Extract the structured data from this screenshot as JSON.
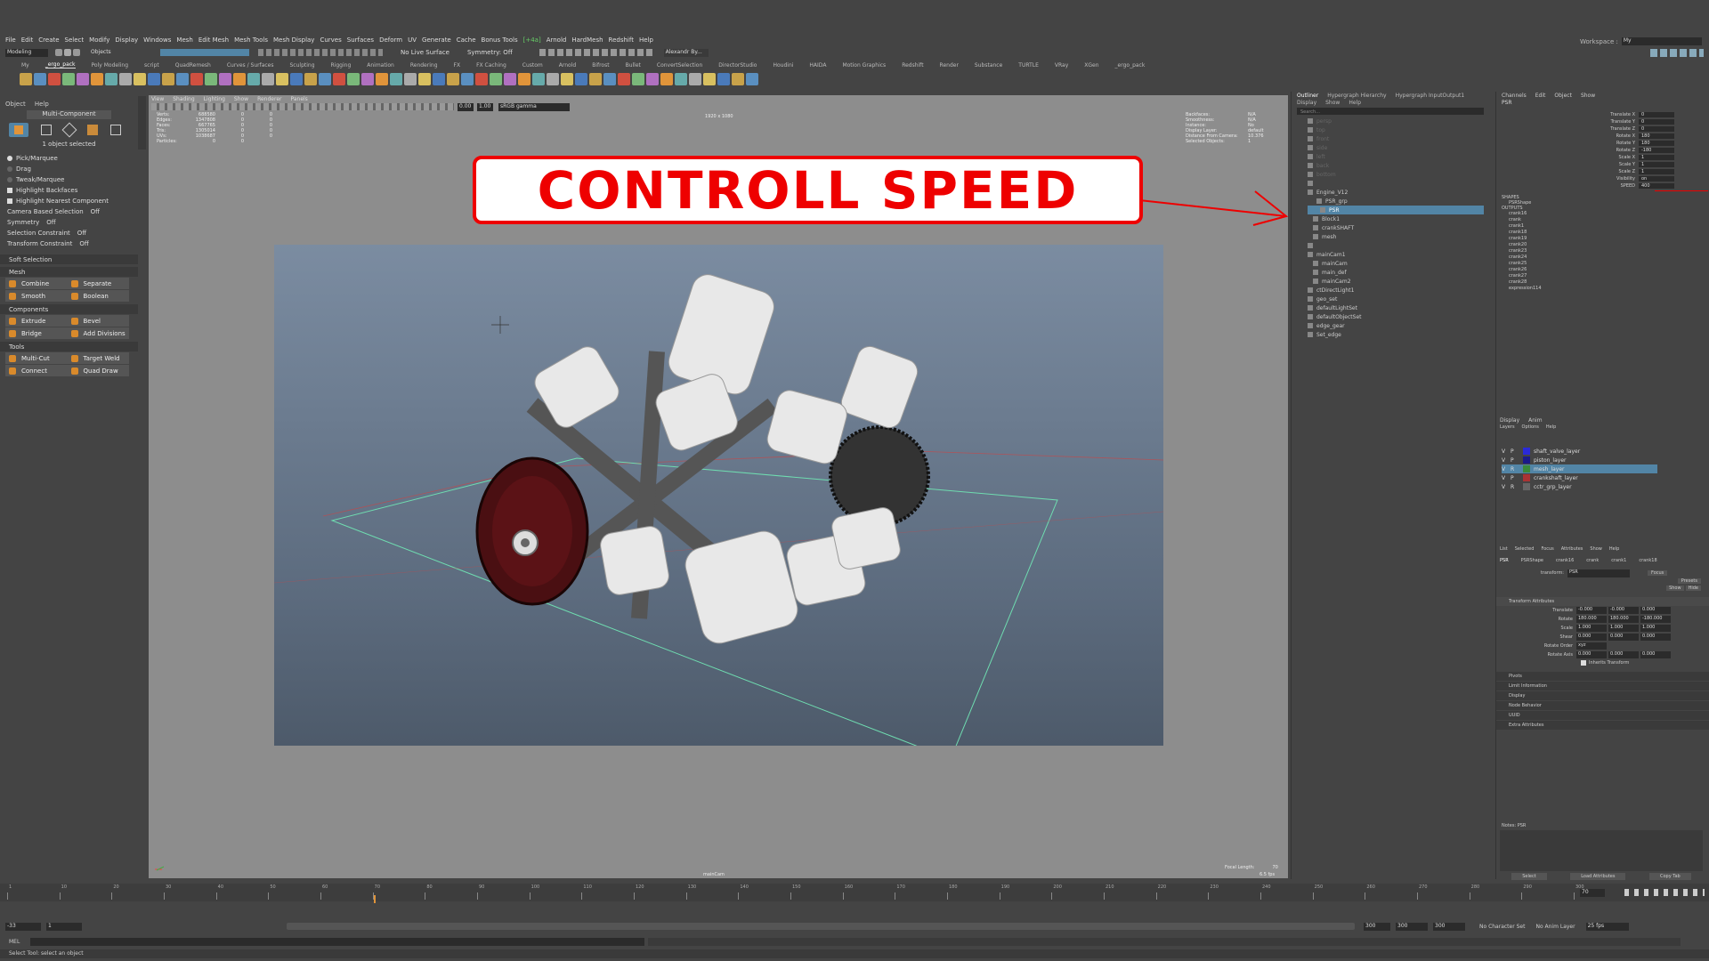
{
  "menubar": [
    "File",
    "Edit",
    "Create",
    "Select",
    "Modify",
    "Display",
    "Windows",
    "Mesh",
    "Edit Mesh",
    "Mesh Tools",
    "Mesh Display",
    "Curves",
    "Surfaces",
    "Deform",
    "UV",
    "Generate",
    "Cache",
    "Bonus Tools",
    "[+4a]",
    "Arnold",
    "HardMesh",
    "Redshift",
    "Help"
  ],
  "workspace": {
    "label": "Workspace :",
    "value": "My"
  },
  "statusline": {
    "mode": "Modeling",
    "objects": "Objects",
    "live": "No Live Surface",
    "symmetry": "Symmetry: Off",
    "user": "Alexandr By..."
  },
  "shelf_tabs": [
    "My",
    "_ergo_pack",
    "Poly Modeling",
    "script",
    "QuadRemesh",
    "Curves / Surfaces",
    "Sculpting",
    "Rigging",
    "Animation",
    "Rendering",
    "FX",
    "FX Caching",
    "Custom",
    "Arnold",
    "Bifrost",
    "Bullet",
    "ConvertSelection",
    "DirectorStudio",
    "Houdini",
    "HAIDA",
    "Motion Graphics",
    "Redshift",
    "Render",
    "Substance",
    "TURTLE",
    "VRay",
    "XGen",
    "_ergo_pack"
  ],
  "toolbox": {
    "menu": [
      "Object",
      "Help"
    ],
    "title": "Multi-Component",
    "selected": "1 object selected",
    "options": [
      "Pick/Marquee",
      "Drag",
      "Tweak/Marquee",
      "Highlight Backfaces",
      "Highlight Nearest Component"
    ],
    "camera_sel": "Camera Based Selection",
    "camera_sel_val": "Off",
    "symmetry": "Symmetry",
    "symmetry_val": "Off",
    "sel_constraint": "Selection Constraint",
    "sel_constraint_val": "Off",
    "transform_constraint": "Transform Constraint",
    "transform_constraint_val": "Off",
    "soft_selection": "Soft Selection",
    "mesh": "Mesh",
    "mesh_buttons": [
      [
        "Combine",
        "Separate"
      ],
      [
        "Smooth",
        "Boolean"
      ]
    ],
    "components": "Components",
    "comp_buttons": [
      [
        "Extrude",
        "Bevel"
      ],
      [
        "Bridge",
        "Add Divisions"
      ]
    ],
    "tools": "Tools",
    "tool_buttons": [
      [
        "Multi-Cut",
        "Target Weld"
      ],
      [
        "Connect",
        "Quad Draw"
      ]
    ]
  },
  "viewport": {
    "menu": [
      "View",
      "Shading",
      "Lighting",
      "Show",
      "Renderer",
      "Panels"
    ],
    "exposure": "0.00",
    "gamma": "1.00",
    "colorspace": "sRGB gamma",
    "resolution": "1920 x 1080",
    "hud_left": [
      [
        "Verts:",
        "688580",
        "0",
        "0"
      ],
      [
        "Edges:",
        "1347808",
        "0",
        "0"
      ],
      [
        "Faces:",
        "667765",
        "0",
        "0"
      ],
      [
        "Tris:",
        "1305014",
        "0",
        "0"
      ],
      [
        "UVs:",
        "1038687",
        "0",
        "0"
      ],
      [
        "Particles:",
        "0",
        "0"
      ]
    ],
    "hud_right": [
      [
        "Backfaces:",
        "N/A"
      ],
      [
        "Smoothness:",
        "N/A"
      ],
      [
        "Instance:",
        "No"
      ],
      [
        "Display Layer:",
        "default"
      ],
      [
        "Distance From Camera:",
        "10.376"
      ],
      [
        "Selected Objects:",
        "1"
      ]
    ],
    "camera": "mainCam",
    "focal_label": "Focal Length:",
    "focal_value": "70",
    "fps": "6.5 fps"
  },
  "callout": "CONTROLL SPEED",
  "outliner": {
    "tabs": [
      "Outliner",
      "Hypergraph Hierarchy",
      "Hypergraph InputOutput1"
    ],
    "menu": [
      "Display",
      "Show",
      "Help"
    ],
    "search_placeholder": "Search...",
    "items": [
      "persp",
      "top",
      "front",
      "side",
      "left",
      "back",
      "bottom",
      "",
      "Engine_V12",
      "PSR_grp",
      "PSR",
      "Block1",
      "crankSHAFT",
      "mesh",
      "",
      "mainCam1",
      "mainCam",
      "main_def",
      "mainCam2",
      "ctDirectLight1",
      "geo_set",
      "defaultLightSet",
      "defaultObjectSet",
      "edge_gear",
      "Set_edge"
    ]
  },
  "channelbox": {
    "tabs": [
      "Channels",
      "Edit",
      "Object",
      "Show"
    ],
    "object": "PSR",
    "channels": [
      [
        "Translate X",
        "0"
      ],
      [
        "Translate Y",
        "0"
      ],
      [
        "Translate Z",
        "0"
      ],
      [
        "Rotate X",
        "180"
      ],
      [
        "Rotate Y",
        "180"
      ],
      [
        "Rotate Z",
        "-180"
      ],
      [
        "Scale X",
        "1"
      ],
      [
        "Scale Y",
        "1"
      ],
      [
        "Scale Z",
        "1"
      ],
      [
        "Visibility",
        "on"
      ],
      [
        "SPEED",
        "400"
      ]
    ],
    "shapes_label": "SHAPES",
    "shape": "PSRShape",
    "outputs_label": "OUTPUTS",
    "outputs": [
      "crank16",
      "crank",
      "crank1",
      "crank18",
      "crank19",
      "crank20",
      "crank23",
      "crank24",
      "crank25",
      "crank26",
      "crank27",
      "crank28",
      "expression114"
    ]
  },
  "layers": {
    "tabs": [
      "Display",
      "Anim"
    ],
    "menu": [
      "Layers",
      "Options",
      "Help"
    ],
    "items": [
      {
        "v": "V",
        "p": "P",
        "name": "shaft_valve_layer",
        "color": "#2a2ad8"
      },
      {
        "v": "V",
        "p": "P",
        "name": "piston_layer",
        "color": "#1a1a8a"
      },
      {
        "v": "V",
        "p": "R",
        "name": "mesh_layer",
        "color": "#3a8a3a"
      },
      {
        "v": "V",
        "p": "P",
        "name": "crankshaft_layer",
        "color": "#a33"
      },
      {
        "v": "V",
        "p": "R",
        "name": "cctr_grp_layer",
        "color": "#666"
      }
    ]
  },
  "attr": {
    "menu": [
      "List",
      "Selected",
      "Focus",
      "Attributes",
      "Show",
      "Help"
    ],
    "tabs": [
      "PSR",
      "PSRShape",
      "crank16",
      "crank",
      "crank1",
      "crank18"
    ],
    "transform_label": "transform:",
    "transform_value": "PSR",
    "focus": "Focus",
    "presets": "Presets",
    "show": "Show",
    "hide": "Hide",
    "section": "Transform Attributes",
    "rows": [
      [
        "Translate",
        "-0.000",
        "-0.000",
        "0.000"
      ],
      [
        "Rotate",
        "180.000",
        "180.000",
        "-180.000"
      ],
      [
        "Scale",
        "1.000",
        "1.000",
        "1.000"
      ],
      [
        "Shear",
        "0.000",
        "0.000",
        "0.000"
      ],
      [
        "Rotate Order",
        "xyz",
        "",
        ""
      ],
      [
        "Rotate Axis",
        "0.000",
        "0.000",
        "0.000"
      ]
    ],
    "inherits": "Inherits Transform",
    "collapsed": [
      "Pivots",
      "Limit Information",
      "Display",
      "Node Behavior",
      "UUID",
      "Extra Attributes"
    ],
    "notes": "Notes: PSR",
    "buttons": [
      "Select",
      "Load Attributes",
      "Copy Tab"
    ]
  },
  "timeline": {
    "current": "70",
    "ticks": [
      "1",
      "10",
      "20",
      "30",
      "40",
      "50",
      "60",
      "70",
      "80",
      "90",
      "100",
      "110",
      "120",
      "130",
      "140",
      "150",
      "160",
      "170",
      "180",
      "190",
      "200",
      "210",
      "220",
      "230",
      "240",
      "250",
      "260",
      "270",
      "280",
      "290",
      "300"
    ]
  },
  "range": {
    "start": "-33",
    "start2": "1",
    "end": "300",
    "end2": "300",
    "end3": "300",
    "char_set": "No Character Set",
    "anim_layer": "No Anim Layer",
    "fps": "25 fps"
  },
  "cmd": {
    "label": "MEL"
  },
  "help": "Select Tool: select an object",
  "colors": {
    "accent": "#5285a6",
    "callout": "#e00000",
    "outline": "#6fdcb0"
  }
}
